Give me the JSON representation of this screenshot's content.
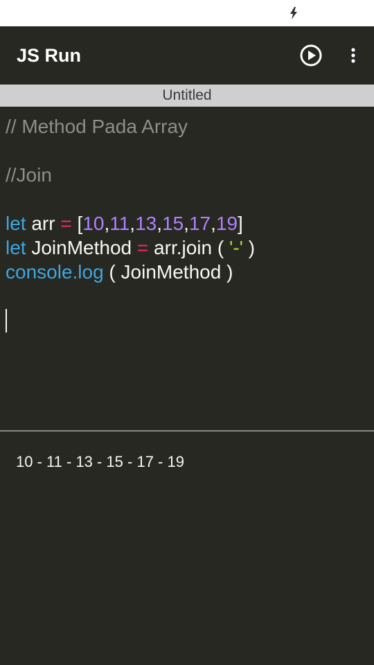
{
  "app": {
    "title": "JS Run",
    "run_icon": "play-circle-icon",
    "menu_icon": "more-vert-icon"
  },
  "status_bar": {
    "icon": "charging-bolt-icon"
  },
  "file": {
    "name": "Untitled"
  },
  "editor": {
    "lines": [
      {
        "tokens": [
          {
            "type": "comment",
            "text": "// Method Pada Array"
          }
        ]
      },
      {
        "tokens": []
      },
      {
        "tokens": [
          {
            "type": "comment",
            "text": "//Join"
          }
        ]
      },
      {
        "tokens": []
      },
      {
        "tokens": [
          {
            "type": "kw",
            "text": "let"
          },
          {
            "type": "plain",
            "text": " arr "
          },
          {
            "type": "op",
            "text": "="
          },
          {
            "type": "plain",
            "text": " ["
          },
          {
            "type": "num",
            "text": "10"
          },
          {
            "type": "plain",
            "text": ","
          },
          {
            "type": "num",
            "text": "11"
          },
          {
            "type": "plain",
            "text": ","
          },
          {
            "type": "num",
            "text": "13"
          },
          {
            "type": "plain",
            "text": ","
          },
          {
            "type": "num",
            "text": "15"
          },
          {
            "type": "plain",
            "text": ","
          },
          {
            "type": "num",
            "text": "17"
          },
          {
            "type": "plain",
            "text": ","
          },
          {
            "type": "num",
            "text": "19"
          },
          {
            "type": "plain",
            "text": "]"
          }
        ]
      },
      {
        "tokens": [
          {
            "type": "kw",
            "text": "let"
          },
          {
            "type": "plain",
            "text": " JoinMethod "
          },
          {
            "type": "op",
            "text": "="
          },
          {
            "type": "plain",
            "text": " arr.join ( "
          },
          {
            "type": "str",
            "text": "'-'"
          },
          {
            "type": "plain",
            "text": " )"
          }
        ]
      },
      {
        "tokens": [
          {
            "type": "kw",
            "text": "console.log"
          },
          {
            "type": "plain",
            "text": " ( JoinMethod )"
          }
        ]
      }
    ]
  },
  "console": {
    "output": "10 - 11 - 13 - 15 - 17 - 19"
  },
  "colors": {
    "background": "#272822",
    "keyword": "#3fa6e0",
    "operator": "#f92672",
    "number": "#ae81ff",
    "string": "#a6e22e",
    "comment": "#8f8f86"
  }
}
